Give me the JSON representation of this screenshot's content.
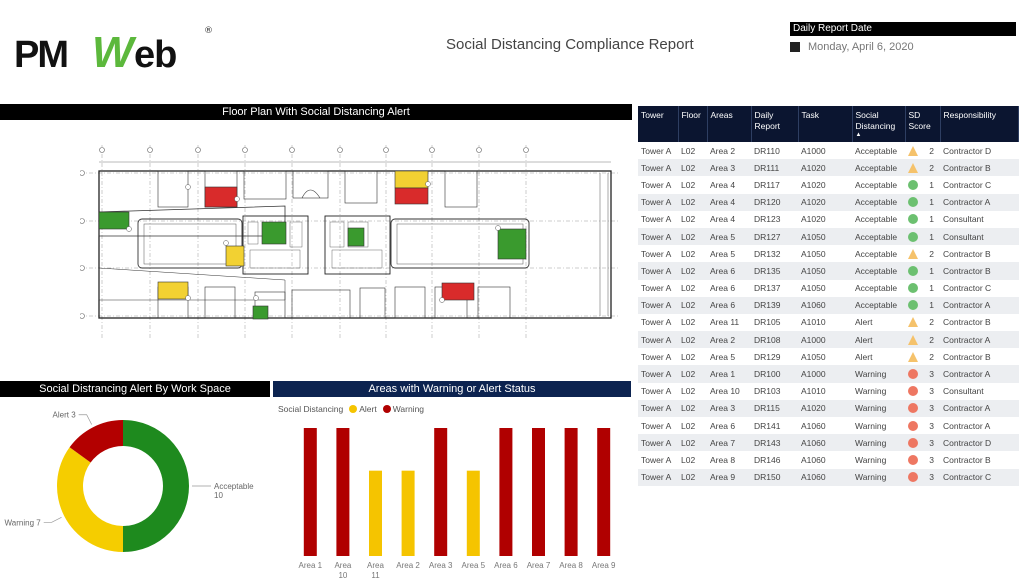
{
  "logo": {
    "pm": "PM",
    "w": "W",
    "eb": "eb",
    "reg": "®"
  },
  "header": {
    "title": "Social Distancing Compliance Report",
    "date_label": "Daily Report Date",
    "date_value": "Monday, April 6, 2020"
  },
  "panels": {
    "floorplan_title": "Floor Plan With Social Distancing Alert",
    "donut_title": "Social Distrancing Alert By Work Space",
    "bar_title": "Areas with Warning or Alert Status"
  },
  "colors": {
    "acceptable": "#1e8a1e",
    "alert_donut": "#b30000",
    "warning_donut": "#f5cd00",
    "alert_bar": "#f5c400",
    "warning_bar": "#b00000",
    "score_green": "#6cc070",
    "score_red": "#ee7762",
    "score_yellow": "#f5c26b",
    "plan_red": "#d92b2b",
    "plan_yellow": "#f2d132",
    "plan_green": "#3a9a2e"
  },
  "table": {
    "columns": [
      "Tower",
      "Floor",
      "Areas",
      "Daily Report",
      "Task",
      "Social Distancing",
      "SD Score",
      "Responsibility"
    ],
    "sort_indicator": "▲",
    "rows": [
      {
        "tower": "Tower A",
        "floor": "L02",
        "area": "Area 2",
        "report": "DR110",
        "task": "A1000",
        "status": "Acceptable",
        "icon": "triangle",
        "score": "2",
        "resp": "Contractor D"
      },
      {
        "tower": "Tower A",
        "floor": "L02",
        "area": "Area 3",
        "report": "DR111",
        "task": "A1020",
        "status": "Acceptable",
        "icon": "triangle",
        "score": "2",
        "resp": "Contractor B"
      },
      {
        "tower": "Tower A",
        "floor": "L02",
        "area": "Area 4",
        "report": "DR117",
        "task": "A1020",
        "status": "Acceptable",
        "icon": "green",
        "score": "1",
        "resp": "Contractor C"
      },
      {
        "tower": "Tower A",
        "floor": "L02",
        "area": "Area 4",
        "report": "DR120",
        "task": "A1020",
        "status": "Acceptable",
        "icon": "green",
        "score": "1",
        "resp": "Contractor A"
      },
      {
        "tower": "Tower A",
        "floor": "L02",
        "area": "Area 4",
        "report": "DR123",
        "task": "A1020",
        "status": "Acceptable",
        "icon": "green",
        "score": "1",
        "resp": "Consultant"
      },
      {
        "tower": "Tower A",
        "floor": "L02",
        "area": "Area 5",
        "report": "DR127",
        "task": "A1050",
        "status": "Acceptable",
        "icon": "green",
        "score": "1",
        "resp": "Consultant"
      },
      {
        "tower": "Tower A",
        "floor": "L02",
        "area": "Area 5",
        "report": "DR132",
        "task": "A1050",
        "status": "Acceptable",
        "icon": "triangle",
        "score": "2",
        "resp": "Contractor B"
      },
      {
        "tower": "Tower A",
        "floor": "L02",
        "area": "Area 6",
        "report": "DR135",
        "task": "A1050",
        "status": "Acceptable",
        "icon": "green",
        "score": "1",
        "resp": "Contractor B"
      },
      {
        "tower": "Tower A",
        "floor": "L02",
        "area": "Area 6",
        "report": "DR137",
        "task": "A1050",
        "status": "Acceptable",
        "icon": "green",
        "score": "1",
        "resp": "Contractor C"
      },
      {
        "tower": "Tower A",
        "floor": "L02",
        "area": "Area 6",
        "report": "DR139",
        "task": "A1060",
        "status": "Acceptable",
        "icon": "green",
        "score": "1",
        "resp": "Contractor A"
      },
      {
        "tower": "Tower A",
        "floor": "L02",
        "area": "Area 11",
        "report": "DR105",
        "task": "A1010",
        "status": "Alert",
        "icon": "triangle",
        "score": "2",
        "resp": "Contractor B"
      },
      {
        "tower": "Tower A",
        "floor": "L02",
        "area": "Area 2",
        "report": "DR108",
        "task": "A1000",
        "status": "Alert",
        "icon": "triangle",
        "score": "2",
        "resp": "Contractor A"
      },
      {
        "tower": "Tower A",
        "floor": "L02",
        "area": "Area 5",
        "report": "DR129",
        "task": "A1050",
        "status": "Alert",
        "icon": "triangle",
        "score": "2",
        "resp": "Contractor B"
      },
      {
        "tower": "Tower A",
        "floor": "L02",
        "area": "Area 1",
        "report": "DR100",
        "task": "A1000",
        "status": "Warning",
        "icon": "red",
        "score": "3",
        "resp": "Contractor A"
      },
      {
        "tower": "Tower A",
        "floor": "L02",
        "area": "Area 10",
        "report": "DR103",
        "task": "A1010",
        "status": "Warning",
        "icon": "red",
        "score": "3",
        "resp": "Consultant"
      },
      {
        "tower": "Tower A",
        "floor": "L02",
        "area": "Area 3",
        "report": "DR115",
        "task": "A1020",
        "status": "Warning",
        "icon": "red",
        "score": "3",
        "resp": "Contractor A"
      },
      {
        "tower": "Tower A",
        "floor": "L02",
        "area": "Area 6",
        "report": "DR141",
        "task": "A1060",
        "status": "Warning",
        "icon": "red",
        "score": "3",
        "resp": "Contractor A"
      },
      {
        "tower": "Tower A",
        "floor": "L02",
        "area": "Area 7",
        "report": "DR143",
        "task": "A1060",
        "status": "Warning",
        "icon": "red",
        "score": "3",
        "resp": "Contractor D"
      },
      {
        "tower": "Tower A",
        "floor": "L02",
        "area": "Area 8",
        "report": "DR146",
        "task": "A1060",
        "status": "Warning",
        "icon": "red",
        "score": "3",
        "resp": "Contractor B"
      },
      {
        "tower": "Tower A",
        "floor": "L02",
        "area": "Area 9",
        "report": "DR150",
        "task": "A1060",
        "status": "Warning",
        "icon": "red",
        "score": "3",
        "resp": "Contractor C"
      }
    ]
  },
  "chart_data": [
    {
      "type": "pie",
      "title": "Social Distrancing Alert By Work Space",
      "donut": true,
      "slices": [
        {
          "label": "Acceptable",
          "value": 10,
          "color": "#1e8a1e"
        },
        {
          "label": "Warning",
          "value": 7,
          "color": "#f5cd00"
        },
        {
          "label": "Alert",
          "value": 3,
          "color": "#b30000"
        }
      ]
    },
    {
      "type": "bar",
      "title": "Areas with Warning or Alert Status",
      "legend_title": "Social Distancing",
      "legend": [
        {
          "name": "Alert",
          "color": "#f5c400"
        },
        {
          "name": "Warning",
          "color": "#b00000"
        }
      ],
      "legend_position": "top-left",
      "categories": [
        "Area 1",
        "Area 10",
        "Area 11",
        "Area 2",
        "Area 3",
        "Area 5",
        "Area 6",
        "Area 7",
        "Area 8",
        "Area 9"
      ],
      "series": [
        {
          "name": "Warning",
          "values": [
            3,
            3,
            null,
            null,
            3,
            null,
            3,
            3,
            3,
            3
          ]
        },
        {
          "name": "Alert",
          "values": [
            null,
            null,
            2,
            2,
            null,
            2,
            null,
            null,
            null,
            null
          ]
        }
      ],
      "ylim": [
        0,
        3
      ],
      "grid": false
    }
  ]
}
